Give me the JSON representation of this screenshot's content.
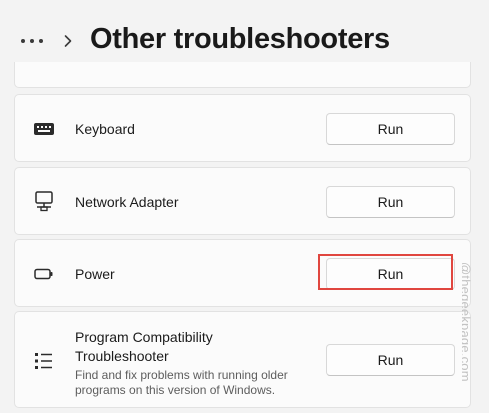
{
  "header": {
    "more_label": "•••",
    "breadcrumb_separator": "chevron-right",
    "title": "Other troubleshooters"
  },
  "troubleshooters": [
    {
      "icon": "keyboard-icon",
      "label": "Keyboard",
      "description": "",
      "button_label": "Run"
    },
    {
      "icon": "network-adapter-icon",
      "label": "Network Adapter",
      "description": "",
      "button_label": "Run"
    },
    {
      "icon": "battery-icon",
      "label": "Power",
      "description": "",
      "button_label": "Run",
      "highlighted": true
    },
    {
      "icon": "list-icon",
      "label": "Program Compatibility Troubleshooter",
      "description": "Find and fix problems with running older programs on this version of Windows.",
      "button_label": "Run"
    }
  ],
  "watermark": "@thegeekpage.com",
  "colors": {
    "background": "#f3f3f3",
    "card": "#fbfbfb",
    "highlight": "#e0463f"
  }
}
